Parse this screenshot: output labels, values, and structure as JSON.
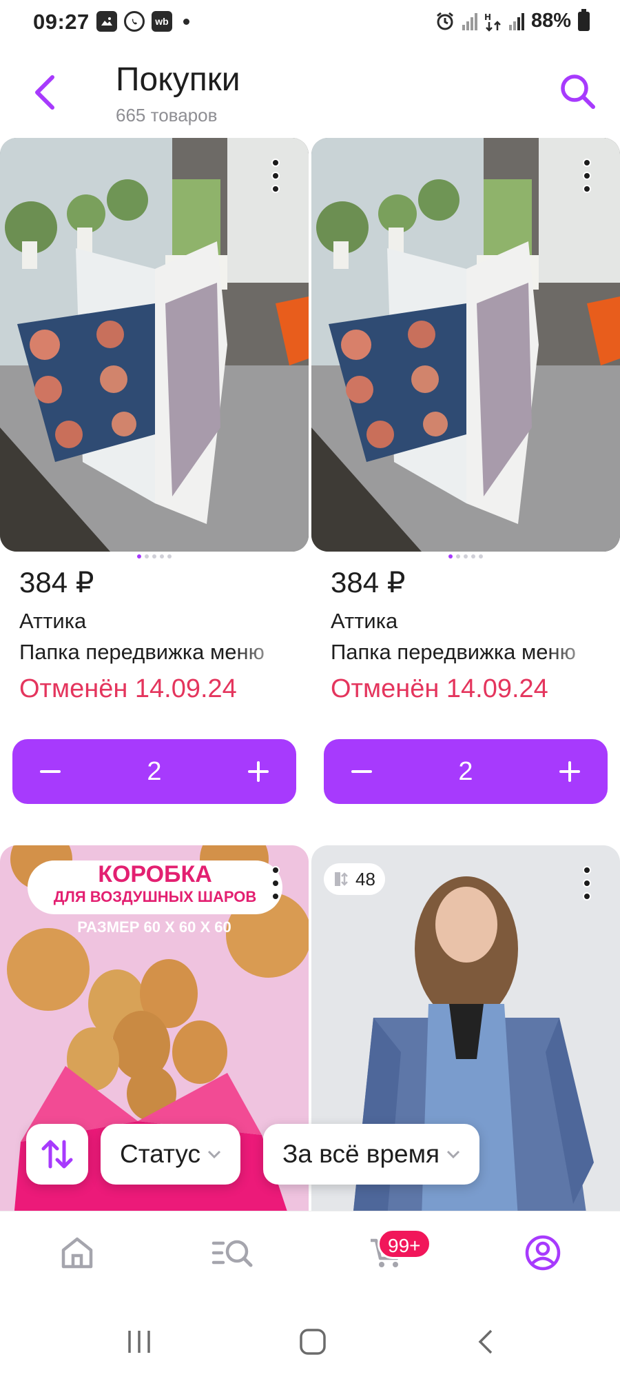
{
  "status_bar": {
    "time": "09:27",
    "battery": "88%",
    "notification_icons": [
      "gallery-icon",
      "whatsapp-icon",
      "wb-icon"
    ],
    "wb_label": "wb",
    "right_icons": [
      "alarm-icon",
      "signal-icon",
      "data-icon",
      "signal-icon"
    ]
  },
  "header": {
    "title": "Покупки",
    "subtitle": "665 товаров"
  },
  "products": [
    {
      "price": "384 ₽",
      "brand": "Аттика",
      "name": "Папка передвижка меню",
      "status": "Отменён 14.09.24",
      "quantity": "2"
    },
    {
      "price": "384 ₽",
      "brand": "Аттика",
      "name": "Папка передвижка меню",
      "status": "Отменён 14.09.24",
      "quantity": "2"
    }
  ],
  "lower_cards": {
    "balloon_box": {
      "headline": "КОРОБКА",
      "sub": "ДЛЯ ВОЗДУШНЫХ ШАРОВ",
      "size": "РАЗМЕР 60 Х 60 Х 60"
    },
    "coat": {
      "size_badge": "48"
    }
  },
  "filters": {
    "sort_icon": "sort-arrows-icon",
    "status_label": "Статус",
    "period_label": "За всё время"
  },
  "bottom_nav": {
    "items": [
      "home-icon",
      "catalog-search-icon",
      "cart-icon",
      "profile-icon"
    ],
    "cart_badge": "99+"
  },
  "colors": {
    "accent": "#a73afd",
    "status_cancelled": "#e4355d",
    "badge": "#f1165a"
  }
}
